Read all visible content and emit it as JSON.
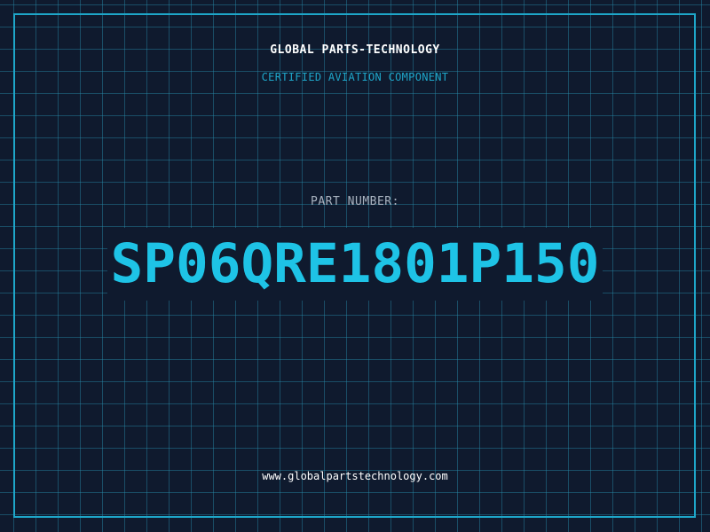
{
  "header": {
    "company_name": "GLOBAL PARTS-TECHNOLOGY",
    "subtitle": "CERTIFIED AVIATION COMPONENT"
  },
  "part": {
    "label": "PART NUMBER:",
    "number": "SP06QRE1801P150"
  },
  "footer": {
    "website": "www.globalpartstechnology.com"
  },
  "colors": {
    "background": "#0f1a2e",
    "accent": "#1ea6c9",
    "part_number": "#1ec3e6",
    "label": "#a9b3c0",
    "text": "#ffffff"
  }
}
